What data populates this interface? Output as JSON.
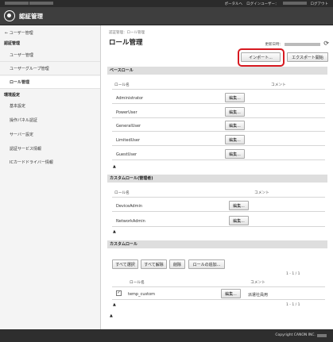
{
  "topbar": {
    "portal_link": "ポータルへ",
    "login_user_label": "ログインユーザー：",
    "logout_link": "ログアウト"
  },
  "header": {
    "title": "認証管理"
  },
  "sidebar": {
    "back": "ユーザー管理",
    "section_auth": "認証管理",
    "items_auth": [
      "ユーザー管理",
      "ユーザーグループ管理",
      "ロール管理"
    ],
    "section_settings": "環境設定",
    "items_settings": [
      "基本設定",
      "操作パネル認証",
      "サーバー設定",
      "認証サービス情報",
      "ICカードドライバー情報"
    ]
  },
  "main": {
    "breadcrumb": "認証管理：ロール管理",
    "title": "ロール管理",
    "updated_label": "更新日時：",
    "import_button": "インポート...",
    "export_button": "エクスポート開始",
    "base_roles": {
      "header": "ベースロール",
      "col_name": "ロール名",
      "col_comment": "コメント",
      "rows": [
        {
          "name": "Administrator",
          "edit": "編集..."
        },
        {
          "name": "PowerUser",
          "edit": "編集..."
        },
        {
          "name": "GeneralUser",
          "edit": "編集..."
        },
        {
          "name": "LimitedUser",
          "edit": "編集..."
        },
        {
          "name": "GuestUser",
          "edit": "編集..."
        }
      ]
    },
    "custom_admin": {
      "header": "カスタムロール(管理者)",
      "col_name": "ロール名",
      "col_comment": "コメント",
      "rows": [
        {
          "name": "DeviceAdmin",
          "edit": "編集..."
        },
        {
          "name": "NetworkAdmin",
          "edit": "編集..."
        }
      ]
    },
    "custom": {
      "header": "カスタムロール",
      "buttons": {
        "select_all": "すべて選択",
        "clear_all": "すべて解除",
        "delete": "削除",
        "add": "ロールの追加..."
      },
      "pager_top": "1 - 1 / 1",
      "pager_bottom": "1 - 1 / 1",
      "col_name": "ロール名",
      "col_comment": "コメント",
      "rows": [
        {
          "name": "temp_custom",
          "edit": "編集...",
          "comment": "派遣社員用",
          "checked": "✓"
        }
      ]
    },
    "collapse_glyph": "▲"
  },
  "footer": {
    "copyright": "Copyright CANON INC."
  }
}
